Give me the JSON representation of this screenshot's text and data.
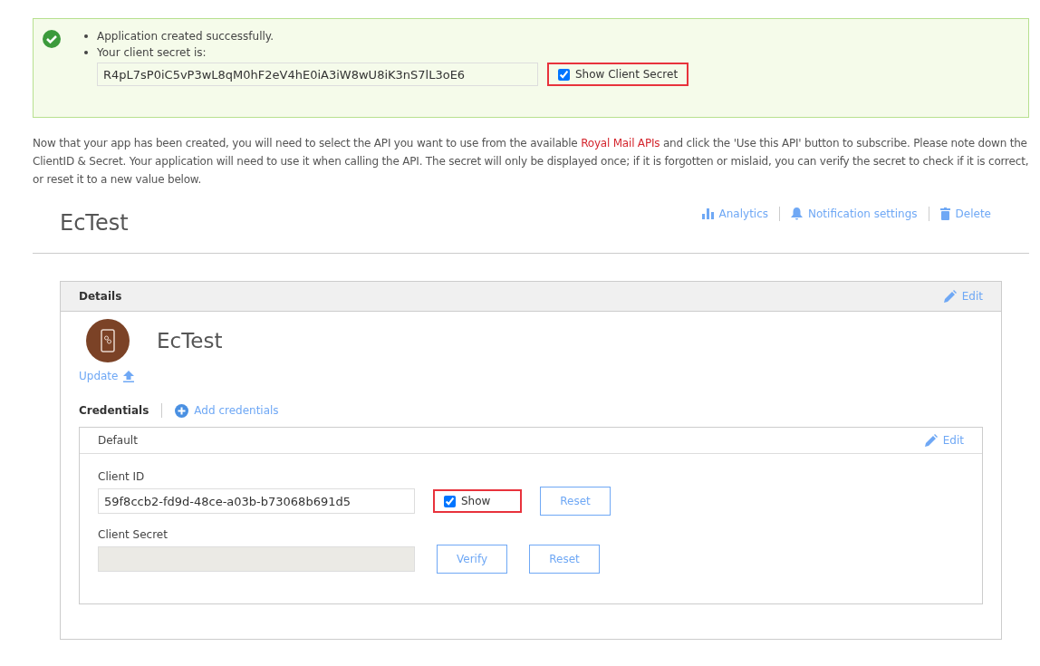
{
  "alert": {
    "messages": [
      "Application created successfully.",
      "Your client secret is:"
    ],
    "secret_value": "R4pL7sP0iC5vP3wL8qM0hF2eV4hE0iA3iW8wU8iK3nS7lL3oE6",
    "show_secret": {
      "label": "Show Client Secret",
      "checked": true,
      "highlighted": true
    }
  },
  "intro": {
    "before": "Now that your app has been created, you will need to select the API you want to use from the available ",
    "link": "Royal Mail APIs",
    "after": " and click the 'Use this API' button to subscribe. Please note down the ClientID & Secret. Your application will need to use it when calling the API. The secret will only be displayed once; if it is forgotten or mislaid, you can verify the secret to check if it is correct, or reset it to a new value below."
  },
  "app": {
    "title": "EcTest",
    "actions": [
      {
        "kind": "analytics",
        "label": "Analytics"
      },
      {
        "kind": "notification",
        "label": "Notification settings"
      },
      {
        "kind": "delete",
        "label": "Delete"
      }
    ]
  },
  "details": {
    "heading": "Details",
    "edit": "Edit",
    "name": "EcTest",
    "update": "Update",
    "credentials_label": "Credentials",
    "add_credentials": "Add credentials",
    "credential": {
      "name": "Default",
      "edit": "Edit",
      "client_id_label": "Client ID",
      "client_id": "59f8ccb2-fd9d-48ce-a03b-b73068b691d5",
      "show": {
        "label": "Show",
        "checked": true,
        "highlighted": true
      },
      "reset_id": "Reset",
      "client_secret_label": "Client Secret",
      "secret_disabled": true,
      "verify": "Verify",
      "reset_secret": "Reset"
    }
  }
}
